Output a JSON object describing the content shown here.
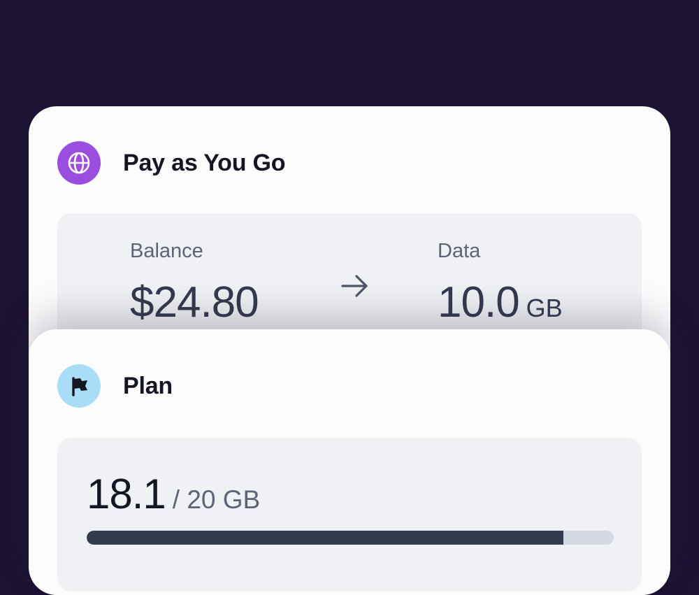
{
  "payg_card": {
    "title": "Pay as You Go",
    "icon": "globe-icon",
    "icon_bg": "#9b4de0",
    "balance_label": "Balance",
    "balance_value": "$24.80",
    "data_label": "Data",
    "data_value": "10.0",
    "data_unit": "GB"
  },
  "plan_card": {
    "title": "Plan",
    "icon": "flag-icon",
    "icon_bg": "#a9dcf7",
    "used": "18.1",
    "total": "/ 20 GB",
    "usage_fraction": 0.905
  },
  "colors": {
    "background": "#1c1232",
    "card": "#fcfcfd",
    "panel": "#eff1f4",
    "progress_fill": "#333b4e",
    "progress_track": "#d3d8e1"
  }
}
